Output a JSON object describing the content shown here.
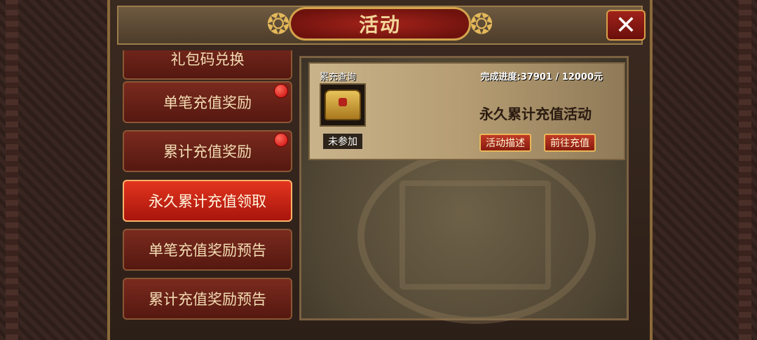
{
  "header": {
    "title": "活动",
    "close_label": "✕"
  },
  "sidebar": {
    "items": [
      {
        "label": "礼包码兑换",
        "active": false,
        "has_dot": false
      },
      {
        "label": "单笔充值奖励",
        "active": false,
        "has_dot": true
      },
      {
        "label": "累计充值奖励",
        "active": false,
        "has_dot": true
      },
      {
        "label": "永久累计充值领取",
        "active": true,
        "has_dot": false
      },
      {
        "label": "单笔充值奖励预告",
        "active": false,
        "has_dot": false
      },
      {
        "label": "累计充值奖励预告",
        "active": false,
        "has_dot": false
      }
    ]
  },
  "card": {
    "label": "累充查询",
    "progress": "完成进度:37901 / 12000元",
    "join_status": "未参加",
    "activity_title": "永久累计充值活动",
    "desc_button": "活动描述",
    "recharge_button": "前往充值"
  },
  "colors": {
    "accent_red": "#c23b24",
    "gold": "#d2a44c",
    "active_red": "#e3351f"
  }
}
